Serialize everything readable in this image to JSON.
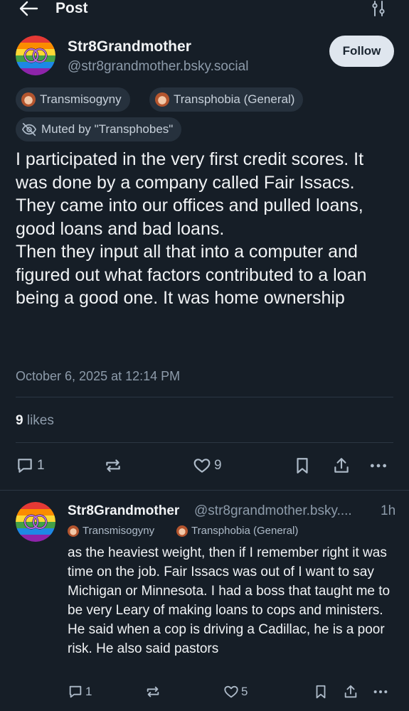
{
  "header": {
    "title": "Post"
  },
  "post": {
    "author_name": "Str8Grandmother",
    "author_handle": "@str8grandmother.bsky.social",
    "follow_label": "Follow",
    "tags": [
      "Transmisogyny",
      "Transphobia (General)"
    ],
    "muted_label": "Muted by \"Transphobes\"",
    "text": "I participated in the very first credit scores. It was done by a company called Fair Issacs.\nThey came into our offices and pulled loans, good loans and bad loans.\nThen they input all that into a computer and figured out what factors contributed to a loan being a good one. It was home ownership",
    "timestamp": "October 6, 2025 at 12:14 PM",
    "likes_count": "9",
    "likes_label": "likes",
    "reply_count": "1",
    "like_count": "9"
  },
  "reply": {
    "author_name": "Str8Grandmother",
    "author_handle": "@str8grandmother.bsky....",
    "time": "1h",
    "tags": [
      "Transmisogyny",
      "Transphobia (General)"
    ],
    "text": "as the heaviest weight, then if I remember right it was time on the job. Fair Issacs was out of I want to say Michigan or Minnesota. I had a boss that taught me to be very Leary of making loans to cops and ministers. He said when a cop is driving a Cadillac, he is a poor risk. He also said pastors",
    "reply_count": "1",
    "like_count": "5"
  },
  "icons": {
    "back": "arrow-left-icon",
    "filter": "sliders-icon",
    "reply": "speech-bubble-icon",
    "repost": "repost-icon",
    "like": "heart-icon",
    "bookmark": "bookmark-icon",
    "share": "share-icon",
    "more": "ellipsis-icon",
    "muted": "eye-off-icon"
  },
  "colors": {
    "background": "#161e27",
    "text": "#f1f3f5",
    "muted_text": "#8d9baa",
    "tag_bg": "#26313d",
    "follow_bg": "#dfe6ee"
  }
}
